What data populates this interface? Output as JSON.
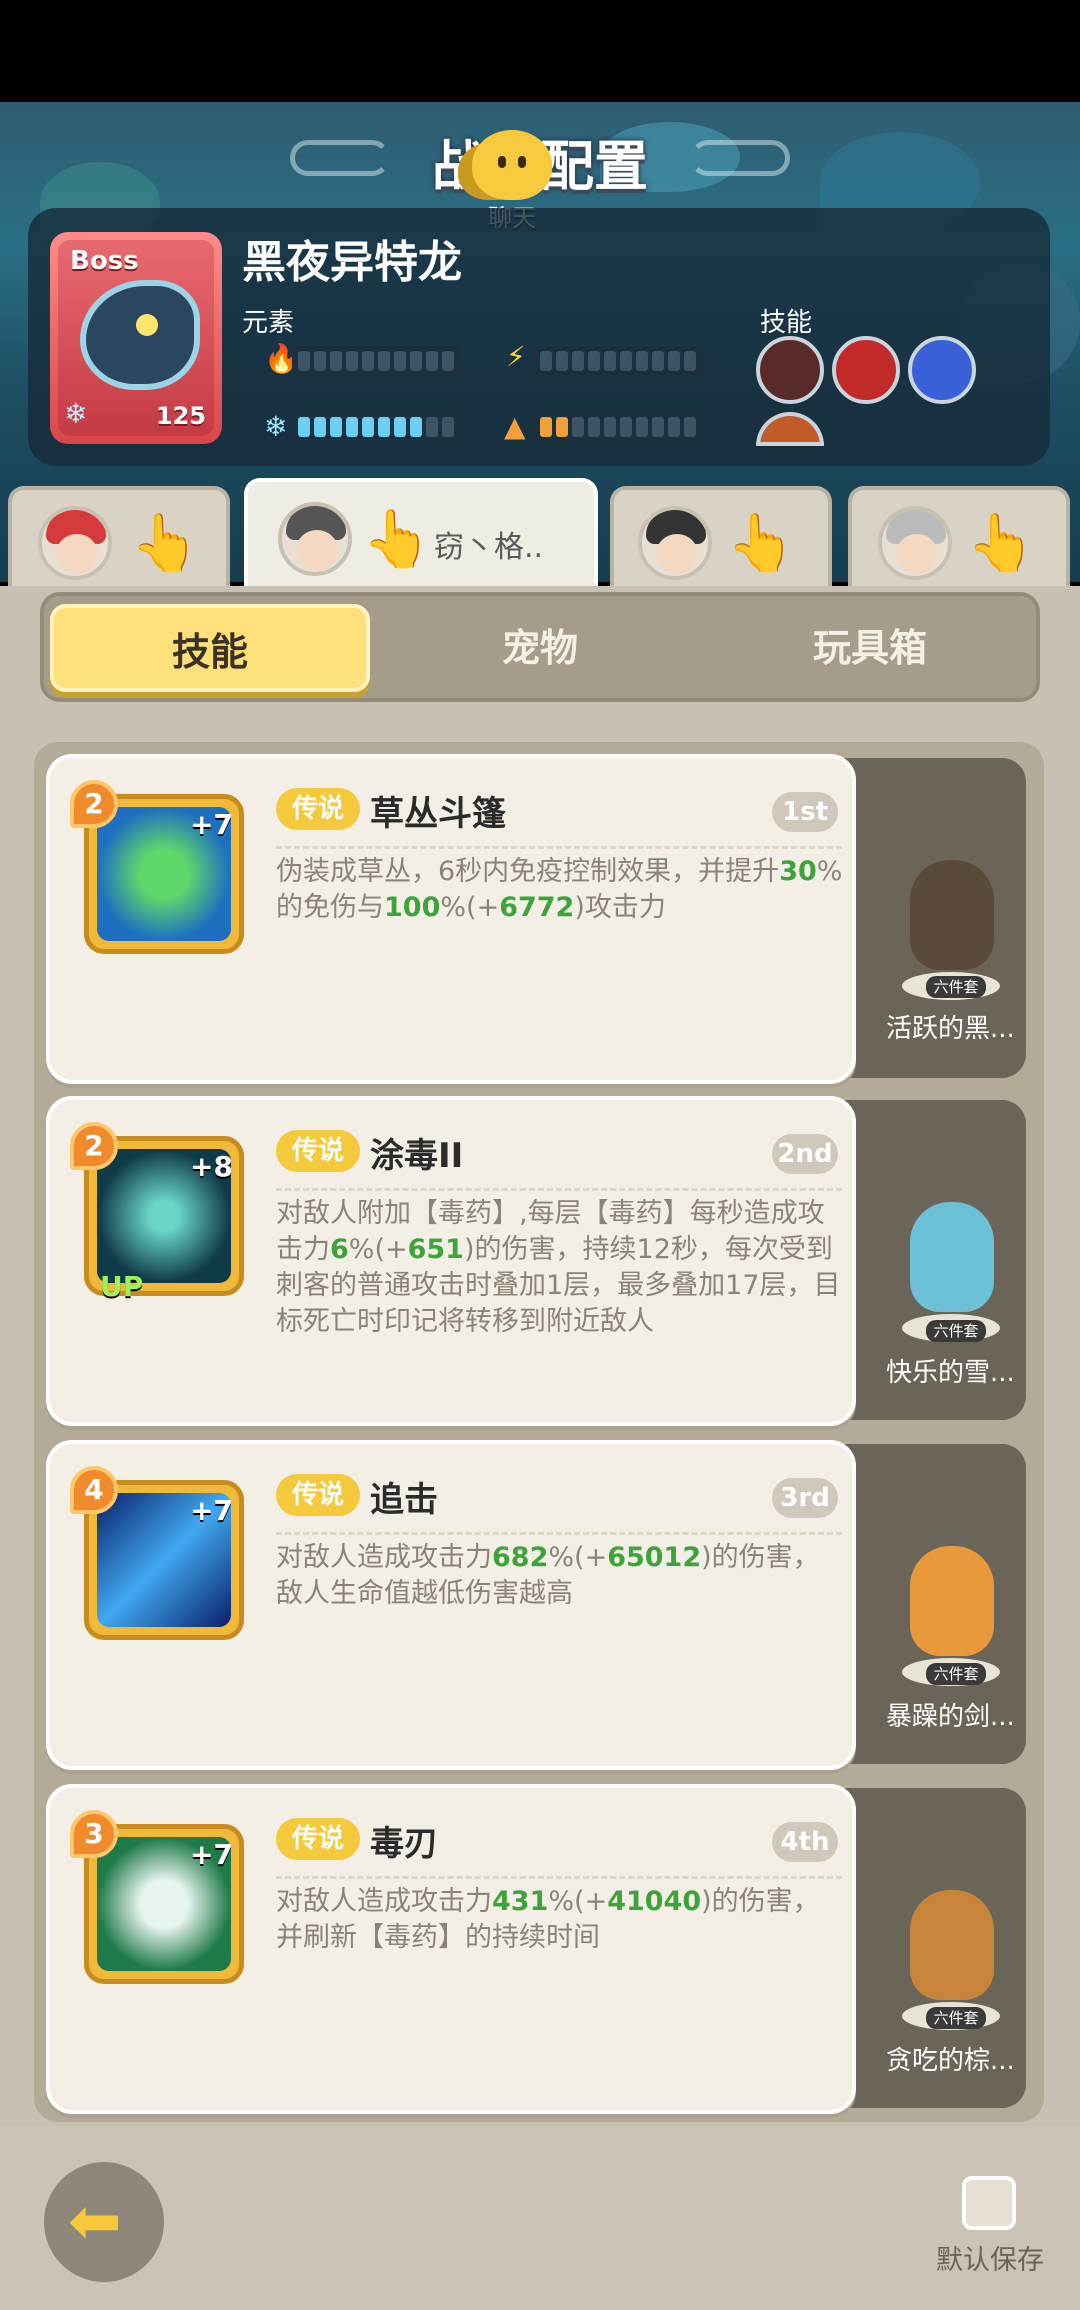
{
  "header": {
    "title": "战斗配置",
    "chat_label": "聊天"
  },
  "boss": {
    "tag": "Boss",
    "name": "黑夜异特龙",
    "level": "125",
    "element_label": "元素",
    "skill_label": "技能"
  },
  "tabs": [
    {
      "name": ""
    },
    {
      "name": "窃丶格.."
    },
    {
      "name": ""
    },
    {
      "name": ""
    }
  ],
  "segments": [
    "技能",
    "宠物",
    "玩具箱"
  ],
  "skills": [
    {
      "level": "2",
      "plus": "+7",
      "rarity": "传说",
      "name": "草丛斗篷",
      "rank": "1st",
      "desc_parts": [
        "伪装成草丛，6秒内免疫控制效果，并提升",
        "30",
        "%的免伤与",
        "100",
        "%(+",
        "6772",
        ")攻击力"
      ],
      "pet": "活跃的黑...",
      "set": "六件套"
    },
    {
      "level": "2",
      "plus": "+8",
      "up": "UP",
      "rarity": "传说",
      "name": "涂毒II",
      "rank": "2nd",
      "desc_parts": [
        "对敌人附加【毒药】,每层【毒药】每秒造成攻击力",
        "6",
        "%(+",
        "651",
        ")的伤害，持续12秒，每次受到刺客的普通攻击时叠加1层，最多叠加17层，目标死亡时印记将转移到附近敌人"
      ],
      "pet": "快乐的雪...",
      "set": "六件套"
    },
    {
      "level": "4",
      "plus": "+7",
      "rarity": "传说",
      "name": "追击",
      "rank": "3rd",
      "desc_parts": [
        "对敌人造成攻击力",
        "682",
        "%(+",
        "65012",
        ")的伤害，敌人生命值越低伤害越高"
      ],
      "pet": "暴躁的剑...",
      "set": "六件套"
    },
    {
      "level": "3",
      "plus": "+7",
      "rarity": "传说",
      "name": "毒刃",
      "rank": "4th",
      "desc_parts": [
        "对敌人造成攻击力",
        "431",
        "%(+",
        "41040",
        ")的伤害，并刷新【毒药】的持续时间"
      ],
      "pet": "贪吃的棕...",
      "set": "六件套"
    }
  ],
  "footer": {
    "default_save_label": "默认保存"
  },
  "colors": {
    "accent": "#fde07a",
    "green": "#3ea33a",
    "badge": "#f5c93c"
  }
}
